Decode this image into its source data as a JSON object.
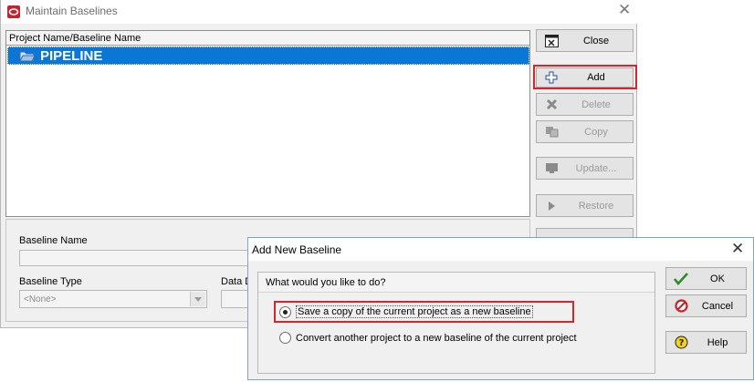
{
  "main_window": {
    "title": "Maintain Baselines",
    "list_header": "Project Name/Baseline Name",
    "selected_item": "PIPELINE",
    "buttons": {
      "close": "Close",
      "add": "Add",
      "delete": "Delete",
      "copy": "Copy",
      "update": "Update...",
      "restore": "Restore"
    },
    "details": {
      "baseline_name_label": "Baseline Name",
      "baseline_type_label": "Baseline Type",
      "baseline_type_value": "<None>",
      "data_date_label": "Data D"
    }
  },
  "dialog": {
    "title": "Add New Baseline",
    "question": "What would you like to do?",
    "options": [
      {
        "label": "Save a copy of the current project as a new baseline",
        "selected": true
      },
      {
        "label": "Convert another project to a new baseline of the current project",
        "selected": false
      }
    ],
    "buttons": {
      "ok": "OK",
      "cancel": "Cancel",
      "help": "Help"
    }
  },
  "colors": {
    "selection": "#0a77d7",
    "highlight_box": "#d4262e",
    "app_icon": "#c0262c"
  }
}
